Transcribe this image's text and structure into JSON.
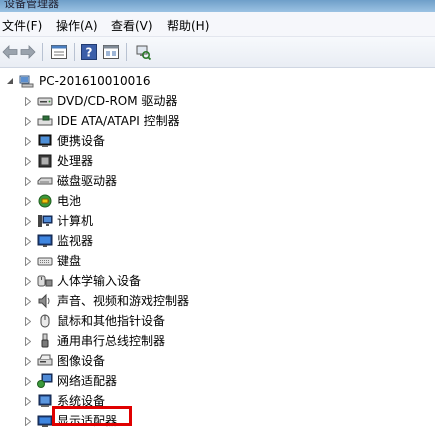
{
  "window": {
    "title": "设备管理器"
  },
  "menu": [
    "文件(F)",
    "操作(A)",
    "查看(V)",
    "帮助(H)"
  ],
  "toolbar_icons": [
    "back-arrow-icon",
    "forward-arrow-icon",
    "properties-grid-icon",
    "help-icon",
    "view-pane-icon",
    "scan-hardware-icon"
  ],
  "tree": {
    "root": "PC-201610010016",
    "items": [
      {
        "label": "DVD/CD-ROM 驱动器",
        "icon": "dvd-drive-icon"
      },
      {
        "label": "IDE ATA/ATAPI 控制器",
        "icon": "ide-controller-icon"
      },
      {
        "label": "便携设备",
        "icon": "portable-device-icon"
      },
      {
        "label": "处理器",
        "icon": "processor-icon"
      },
      {
        "label": "磁盘驱动器",
        "icon": "disk-drive-icon"
      },
      {
        "label": "电池",
        "icon": "battery-icon"
      },
      {
        "label": "计算机",
        "icon": "computer-icon"
      },
      {
        "label": "监视器",
        "icon": "monitor-icon"
      },
      {
        "label": "键盘",
        "icon": "keyboard-icon"
      },
      {
        "label": "人体学输入设备",
        "icon": "hid-icon"
      },
      {
        "label": "声音、视频和游戏控制器",
        "icon": "sound-icon"
      },
      {
        "label": "鼠标和其他指针设备",
        "icon": "mouse-icon"
      },
      {
        "label": "通用串行总线控制器",
        "icon": "usb-icon"
      },
      {
        "label": "图像设备",
        "icon": "imaging-device-icon"
      },
      {
        "label": "网络适配器",
        "icon": "network-adapter-icon"
      },
      {
        "label": "系统设备",
        "icon": "system-device-icon"
      },
      {
        "label": "显示适配器",
        "icon": "display-adapter-icon"
      }
    ]
  },
  "colors": {
    "highlight": "#e00000",
    "accent": "#3b6fb6"
  }
}
